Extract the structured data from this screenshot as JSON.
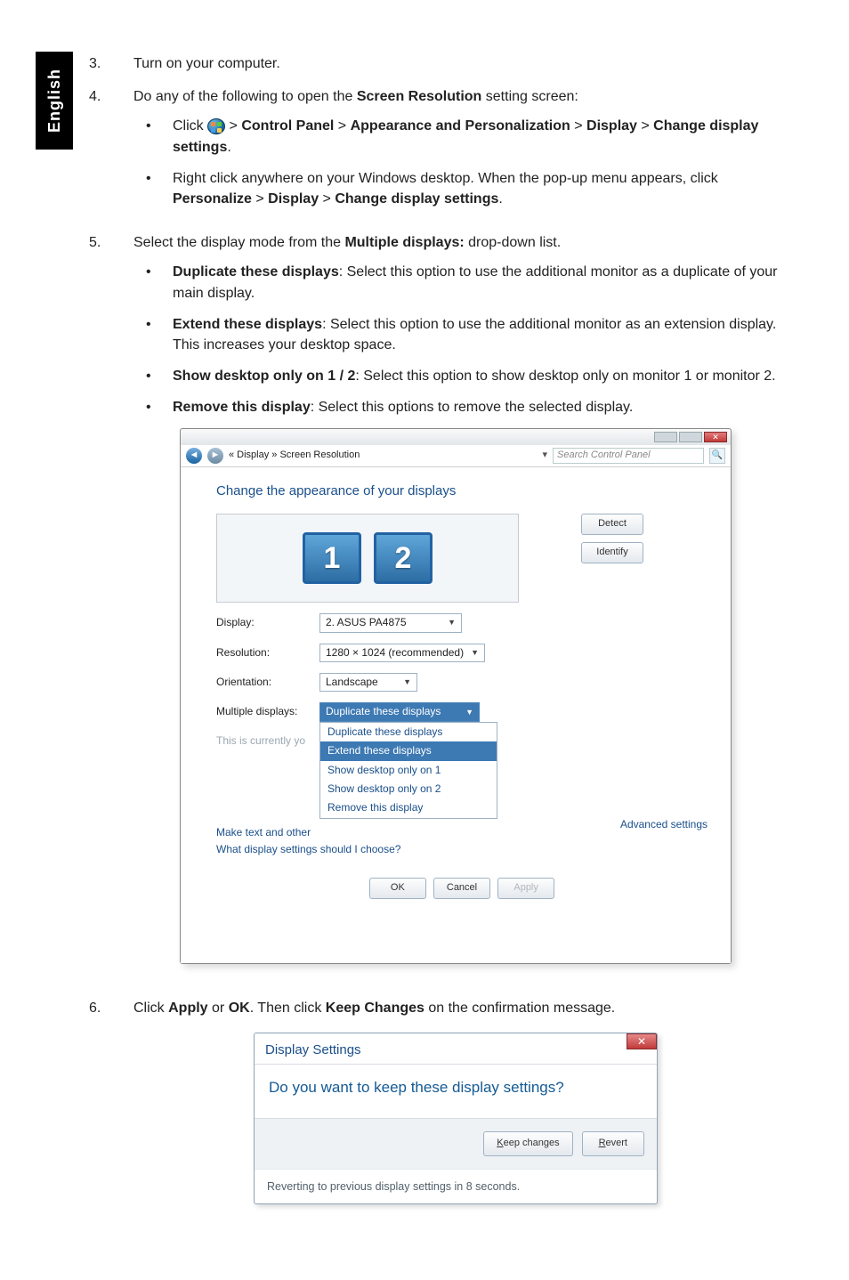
{
  "side_label": "English",
  "steps": {
    "s3": {
      "num": "3.",
      "text": "Turn on your computer."
    },
    "s4": {
      "num": "4.",
      "intro_a": "Do any of the following to open the ",
      "intro_b": "Screen Resolution",
      "intro_c": " setting screen:",
      "bullets": {
        "b1": {
          "t1": "Click ",
          "t2": " > ",
          "cp": "Control Panel",
          "t3": " > ",
          "ap": "Appearance and Personalization",
          "t4": " > ",
          "dp": "Display",
          "t5": " > ",
          "cds": "Change display settings",
          "t6": "."
        },
        "b2": {
          "t1": "Right click anywhere on your Windows desktop. When the pop-up menu appears, click ",
          "p": "Personalize",
          "t2": " > ",
          "d": "Display",
          "t3": " > ",
          "c": "Change display settings",
          "t4": "."
        }
      }
    },
    "s5": {
      "num": "5.",
      "intro_a": "Select the display mode from the ",
      "intro_b": "Multiple displays:",
      "intro_c": " drop-down list.",
      "bullets": {
        "dup": {
          "title": "Duplicate these displays",
          "text": ": Select this option to use the additional monitor as a duplicate of your main display."
        },
        "ext": {
          "title": "Extend these displays",
          "text": ": Select this option to use the additional monitor as an extension display. This increases your desktop space."
        },
        "show": {
          "title": "Show desktop only on 1 / 2",
          "text": ": Select this option to show desktop only on monitor 1 or monitor 2."
        },
        "rem": {
          "title": "Remove this display",
          "text": ": Select this options to remove the selected display."
        }
      }
    },
    "s6": {
      "num": "6.",
      "t1": "Click ",
      "apply": "Apply",
      "t2": " or ",
      "ok": "OK",
      "t3": ". Then click ",
      "keep": "Keep Changes",
      "t4": " on the confirmation message."
    }
  },
  "shot1": {
    "breadcrumb": "« Display » Screen Resolution",
    "search_placeholder": "Search Control Panel",
    "heading": "Change the appearance of your displays",
    "mon1": "1",
    "mon2": "2",
    "btn_detect": "Detect",
    "btn_identify": "Identify",
    "labels": {
      "display": "Display:",
      "resolution": "Resolution:",
      "orientation": "Orientation:",
      "multiple": "Multiple displays:"
    },
    "values": {
      "display": "2. ASUS PA4875",
      "resolution": "1280 × 1024 (recommended)",
      "orientation": "Landscape"
    },
    "dropdown": {
      "sel": "Duplicate these displays",
      "i1": "Duplicate these displays",
      "i2": "Extend these displays",
      "i3": "Show desktop only on 1",
      "i4": "Show desktop only on 2",
      "i5": "Remove this display"
    },
    "currently": "This is currently yo",
    "make_text": "Make text and other",
    "what_link": "What display settings should I choose?",
    "adv_link": "Advanced settings",
    "ok": "OK",
    "cancel": "Cancel",
    "apply": "Apply"
  },
  "shot2": {
    "title": "Display Settings",
    "question": "Do you want to keep these display settings?",
    "keep_u": "K",
    "keep_rest": "eep changes",
    "revert_u": "R",
    "revert_rest": "evert",
    "footer": "Reverting to previous display settings in 8 seconds."
  }
}
